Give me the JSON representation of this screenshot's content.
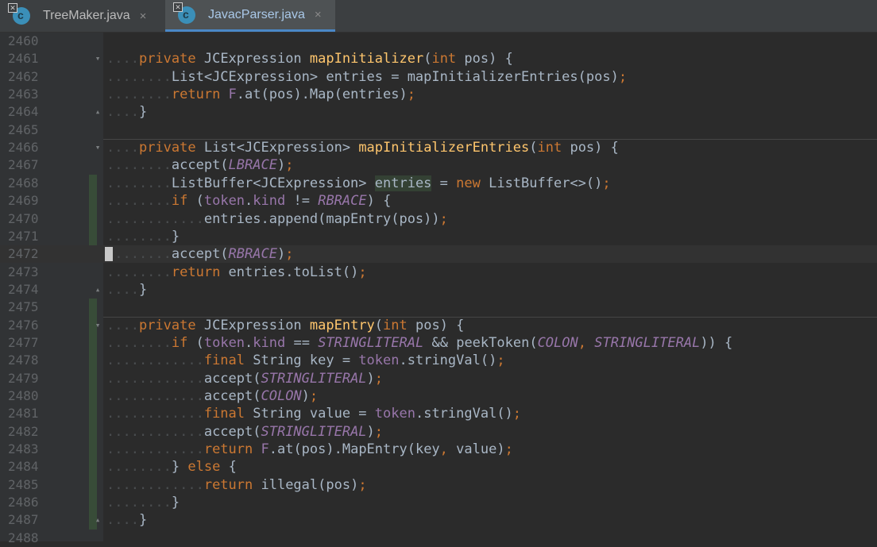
{
  "tabs": [
    {
      "label": "TreeMaker.java",
      "icon": "java-class-icon",
      "close": "×",
      "active": false
    },
    {
      "label": "JavacParser.java",
      "icon": "java-class-icon",
      "close": "×",
      "active": true
    }
  ],
  "colors": {
    "keyword": "#cc7832",
    "method": "#ffc66d",
    "constant": "#9876aa",
    "text": "#a9b7c6",
    "line_number": "#606366",
    "active_tab_underline": "#4a88c7"
  },
  "editor": {
    "current_line": "2472",
    "lines": [
      {
        "num": "2460",
        "tokens": []
      },
      {
        "num": "2461",
        "tokens": [
          [
            "d",
            "...."
          ],
          [
            "k",
            "private"
          ],
          [
            "t",
            " JCExpression "
          ],
          [
            "f",
            "mapInitializer"
          ],
          [
            "t",
            "("
          ],
          [
            "k",
            "int"
          ],
          [
            "t",
            " pos) {"
          ]
        ]
      },
      {
        "num": "2462",
        "tokens": [
          [
            "d",
            "........"
          ],
          [
            "t",
            "List<JCExpression> entries = mapInitializerEntries(pos)"
          ],
          [
            "k",
            ";"
          ]
        ]
      },
      {
        "num": "2463",
        "tokens": [
          [
            "d",
            "........"
          ],
          [
            "k",
            "return "
          ],
          [
            "v",
            "F"
          ],
          [
            "t",
            ".at(pos).Map(entries)"
          ],
          [
            "k",
            ";"
          ]
        ]
      },
      {
        "num": "2464",
        "tokens": [
          [
            "d",
            "...."
          ],
          [
            "t",
            "}"
          ]
        ]
      },
      {
        "num": "2465",
        "tokens": []
      },
      {
        "num": "2466",
        "tokens": [
          [
            "d",
            "...."
          ],
          [
            "k",
            "private"
          ],
          [
            "t",
            " List<JCExpression> "
          ],
          [
            "f",
            "mapInitializerEntries"
          ],
          [
            "t",
            "("
          ],
          [
            "k",
            "int"
          ],
          [
            "t",
            " pos) {"
          ]
        ]
      },
      {
        "num": "2467",
        "tokens": [
          [
            "d",
            "........"
          ],
          [
            "t",
            "accept("
          ],
          [
            "c",
            "LBRACE"
          ],
          [
            "t",
            ")"
          ],
          [
            "k",
            ";"
          ]
        ]
      },
      {
        "num": "2468",
        "tokens": [
          [
            "d",
            "........"
          ],
          [
            "t",
            "ListBuffer<JCExpression> "
          ],
          [
            "h",
            "entries"
          ],
          [
            "t",
            " = "
          ],
          [
            "k",
            "new"
          ],
          [
            "t",
            " ListBuffer<>()"
          ],
          [
            "k",
            ";"
          ]
        ]
      },
      {
        "num": "2469",
        "tokens": [
          [
            "d",
            "........"
          ],
          [
            "k",
            "if"
          ],
          [
            "t",
            " ("
          ],
          [
            "v",
            "token"
          ],
          [
            "t",
            "."
          ],
          [
            "v",
            "kind"
          ],
          [
            "t",
            " != "
          ],
          [
            "c",
            "RBRACE"
          ],
          [
            "t",
            ") {"
          ]
        ]
      },
      {
        "num": "2470",
        "tokens": [
          [
            "d",
            "............"
          ],
          [
            "t",
            "entries.append(mapEntry(pos))"
          ],
          [
            "k",
            ";"
          ]
        ]
      },
      {
        "num": "2471",
        "tokens": [
          [
            "d",
            "........"
          ],
          [
            "t",
            "}"
          ]
        ]
      },
      {
        "num": "2472",
        "tokens": [
          [
            "d",
            "........"
          ],
          [
            "t",
            "accept("
          ],
          [
            "c",
            "RBRACE"
          ],
          [
            "t",
            ")"
          ],
          [
            "k",
            ";"
          ]
        ]
      },
      {
        "num": "2473",
        "tokens": [
          [
            "d",
            "........"
          ],
          [
            "k",
            "return"
          ],
          [
            "t",
            " entries.toList()"
          ],
          [
            "k",
            ";"
          ]
        ]
      },
      {
        "num": "2474",
        "tokens": [
          [
            "d",
            "...."
          ],
          [
            "t",
            "}"
          ]
        ]
      },
      {
        "num": "2475",
        "tokens": []
      },
      {
        "num": "2476",
        "tokens": [
          [
            "d",
            "...."
          ],
          [
            "k",
            "private"
          ],
          [
            "t",
            " JCExpression "
          ],
          [
            "f",
            "mapEntry"
          ],
          [
            "t",
            "("
          ],
          [
            "k",
            "int"
          ],
          [
            "t",
            " pos) {"
          ]
        ]
      },
      {
        "num": "2477",
        "tokens": [
          [
            "d",
            "........"
          ],
          [
            "k",
            "if"
          ],
          [
            "t",
            " ("
          ],
          [
            "v",
            "token"
          ],
          [
            "t",
            "."
          ],
          [
            "v",
            "kind"
          ],
          [
            "t",
            " == "
          ],
          [
            "c",
            "STRINGLITERAL"
          ],
          [
            "t",
            " && peekToken("
          ],
          [
            "c",
            "COLON"
          ],
          [
            "k",
            ","
          ],
          [
            "t",
            " "
          ],
          [
            "c",
            "STRINGLITERAL"
          ],
          [
            "t",
            ")) {"
          ]
        ]
      },
      {
        "num": "2478",
        "tokens": [
          [
            "d",
            "............"
          ],
          [
            "k",
            "final"
          ],
          [
            "t",
            " String key = "
          ],
          [
            "v",
            "token"
          ],
          [
            "t",
            ".stringVal()"
          ],
          [
            "k",
            ";"
          ]
        ]
      },
      {
        "num": "2479",
        "tokens": [
          [
            "d",
            "............"
          ],
          [
            "t",
            "accept("
          ],
          [
            "c",
            "STRINGLITERAL"
          ],
          [
            "t",
            ")"
          ],
          [
            "k",
            ";"
          ]
        ]
      },
      {
        "num": "2480",
        "tokens": [
          [
            "d",
            "............"
          ],
          [
            "t",
            "accept("
          ],
          [
            "c",
            "COLON"
          ],
          [
            "t",
            ")"
          ],
          [
            "k",
            ";"
          ]
        ]
      },
      {
        "num": "2481",
        "tokens": [
          [
            "d",
            "............"
          ],
          [
            "k",
            "final"
          ],
          [
            "t",
            " String value = "
          ],
          [
            "v",
            "token"
          ],
          [
            "t",
            ".stringVal()"
          ],
          [
            "k",
            ";"
          ]
        ]
      },
      {
        "num": "2482",
        "tokens": [
          [
            "d",
            "............"
          ],
          [
            "t",
            "accept("
          ],
          [
            "c",
            "STRINGLITERAL"
          ],
          [
            "t",
            ")"
          ],
          [
            "k",
            ";"
          ]
        ]
      },
      {
        "num": "2483",
        "tokens": [
          [
            "d",
            "............"
          ],
          [
            "k",
            "return "
          ],
          [
            "v",
            "F"
          ],
          [
            "t",
            ".at(pos).MapEntry(key"
          ],
          [
            "k",
            ","
          ],
          [
            "t",
            " value)"
          ],
          [
            "k",
            ";"
          ]
        ]
      },
      {
        "num": "2484",
        "tokens": [
          [
            "d",
            "........"
          ],
          [
            "t",
            "} "
          ],
          [
            "k",
            "else"
          ],
          [
            "t",
            " {"
          ]
        ]
      },
      {
        "num": "2485",
        "tokens": [
          [
            "d",
            "............"
          ],
          [
            "k",
            "return"
          ],
          [
            "t",
            " illegal(pos)"
          ],
          [
            "k",
            ";"
          ]
        ]
      },
      {
        "num": "2486",
        "tokens": [
          [
            "d",
            "........"
          ],
          [
            "t",
            "}"
          ]
        ]
      },
      {
        "num": "2487",
        "tokens": [
          [
            "d",
            "...."
          ],
          [
            "t",
            "}"
          ]
        ]
      },
      {
        "num": "2488",
        "tokens": []
      }
    ]
  }
}
